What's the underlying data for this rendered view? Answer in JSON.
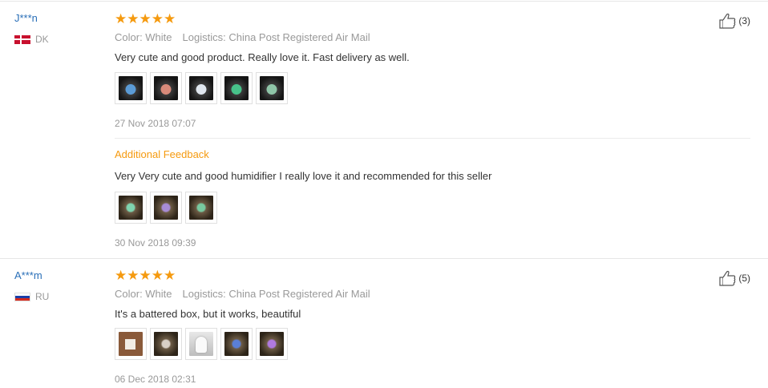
{
  "reviews": [
    {
      "user": "J***n",
      "country": "DK",
      "stars": "★★★★★",
      "color": "Color: White",
      "logistics": "Logistics: China Post Registered Air Mail",
      "text": "Very cute and good product. Really love it. Fast delivery as well.",
      "date": "27 Nov 2018 07:07",
      "likes": "(3)",
      "additional": {
        "label": "Additional Feedback",
        "text": "Very Very cute and good humidifier I really love it and recommended for this seller",
        "date": "30 Nov 2018 09:39"
      }
    },
    {
      "user": "A***m",
      "country": "RU",
      "stars": "★★★★★",
      "color": "Color: White",
      "logistics": "Logistics: China Post Registered Air Mail",
      "text": "It's a battered box, but it works, beautiful",
      "date": "06 Dec 2018 02:31",
      "likes": "(5)"
    }
  ],
  "colors": {
    "accent": "#f59a0f",
    "link": "#2a6fb8",
    "muted": "#999999"
  }
}
